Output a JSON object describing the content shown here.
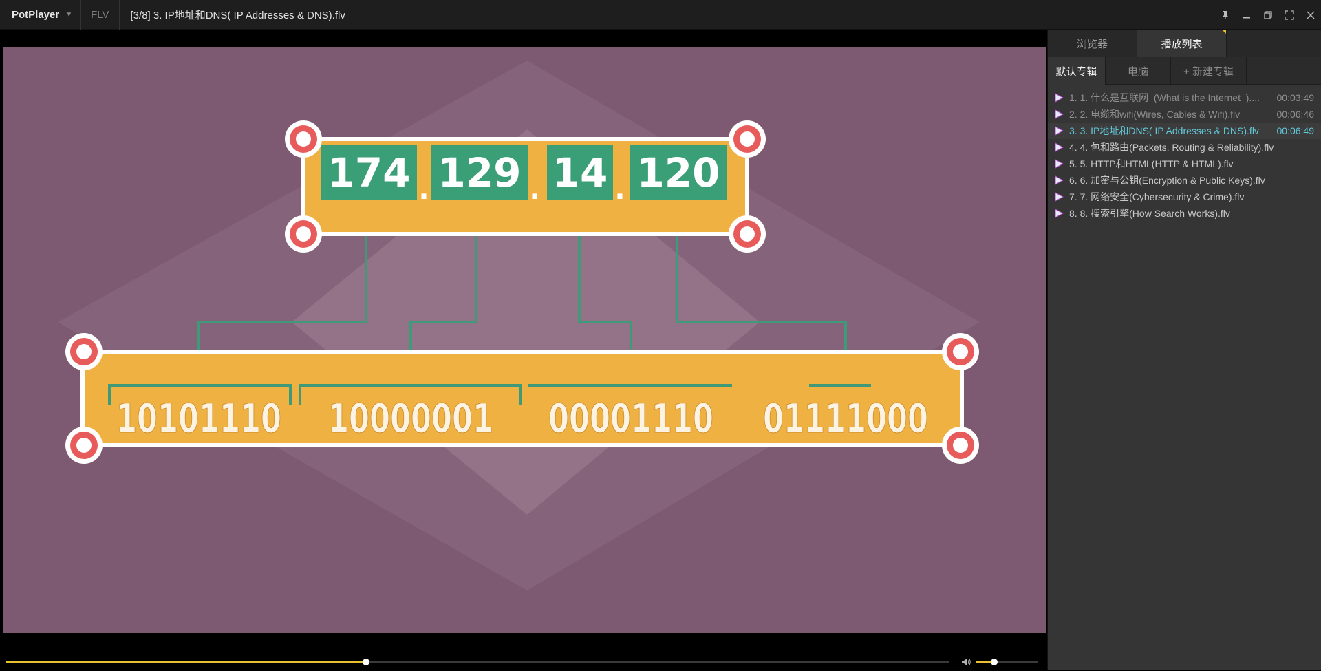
{
  "titlebar": {
    "app_name": "PotPlayer",
    "format": "FLV",
    "file_title": "[3/8] 3. IP地址和DNS( IP Addresses & DNS).flv",
    "icons": [
      "pin-icon",
      "minimize-icon",
      "restore-icon",
      "fullscreen-icon",
      "close-icon"
    ]
  },
  "video": {
    "ip_octets": [
      "174",
      "129",
      "14",
      "120"
    ],
    "ip_separator": ".",
    "binary_octets": [
      "10101110",
      "10000001",
      "00001110",
      "01111000"
    ],
    "colors": {
      "background": "#7d5a72",
      "diamond_light": "#8d6c83",
      "diamond_lighter": "#9a7b90",
      "panel_yellow": "#f0b143",
      "panel_border": "#ffffff",
      "octet_green": "#3a9e76",
      "connector_green": "#3e9a78",
      "handle_red": "#e85b5b"
    }
  },
  "controls": {
    "seek_progress": 0.382,
    "volume_level": 0.3,
    "accent_color": "#e8c12e",
    "volume_icon": "speaker-icon"
  },
  "sidepanel": {
    "tabs": [
      "浏览器",
      "播放列表"
    ],
    "active_tab": 1,
    "subtabs": [
      "默认专辑",
      "电脑",
      "+ 新建专辑"
    ],
    "active_subtab": 0,
    "playlist": [
      {
        "title": "1. 1. 什么是互联网_(What is the Internet_)....",
        "duration": "00:03:49",
        "state": "watched"
      },
      {
        "title": "2. 2. 电缆和wifi(Wires, Cables & Wifi).flv",
        "duration": "00:06:46",
        "state": "watched"
      },
      {
        "title": "3. 3. IP地址和DNS( IP Addresses & DNS).flv",
        "duration": "00:06:49",
        "state": "current"
      },
      {
        "title": "4. 4. 包和路由(Packets, Routing & Reliability).flv",
        "duration": "",
        "state": "normal"
      },
      {
        "title": "5. 5. HTTP和HTML(HTTP & HTML).flv",
        "duration": "",
        "state": "normal"
      },
      {
        "title": "6. 6. 加密与公钥(Encryption & Public Keys).flv",
        "duration": "",
        "state": "normal"
      },
      {
        "title": "7. 7. 网络安全(Cybersecurity & Crime).flv",
        "duration": "",
        "state": "normal"
      },
      {
        "title": "8. 8. 搜索引擎(How Search Works).flv",
        "duration": "",
        "state": "normal"
      }
    ]
  }
}
